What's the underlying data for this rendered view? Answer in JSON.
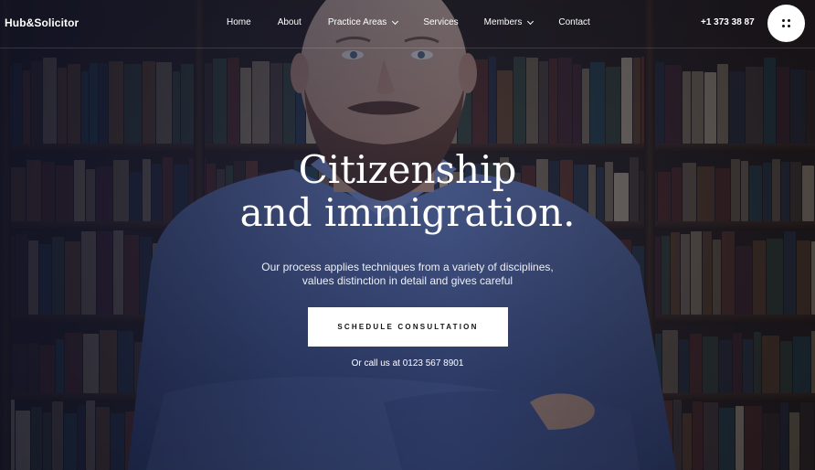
{
  "header": {
    "logo": "Hub&Solicitor",
    "nav": [
      {
        "label": "Home",
        "has_dropdown": false
      },
      {
        "label": "About",
        "has_dropdown": false
      },
      {
        "label": "Practice Areas",
        "has_dropdown": true
      },
      {
        "label": "Services",
        "has_dropdown": false
      },
      {
        "label": "Members",
        "has_dropdown": true
      },
      {
        "label": "Contact",
        "has_dropdown": false
      }
    ],
    "phone": "+1 373 38 87",
    "menu_icon": "grid-dots-icon"
  },
  "hero": {
    "headline_line1": "Citizenship",
    "headline_line2": "and immigration.",
    "subtext_line1": "Our process applies techniques from a variety of disciplines,",
    "subtext_line2": "values distinction in detail and gives careful",
    "cta_label": "SCHEDULE CONSULTATION",
    "call_text": "Or call us at 0123 567 8901"
  },
  "colors": {
    "overlay": "#16203a",
    "button_bg": "#ffffff",
    "text": "#ffffff"
  }
}
